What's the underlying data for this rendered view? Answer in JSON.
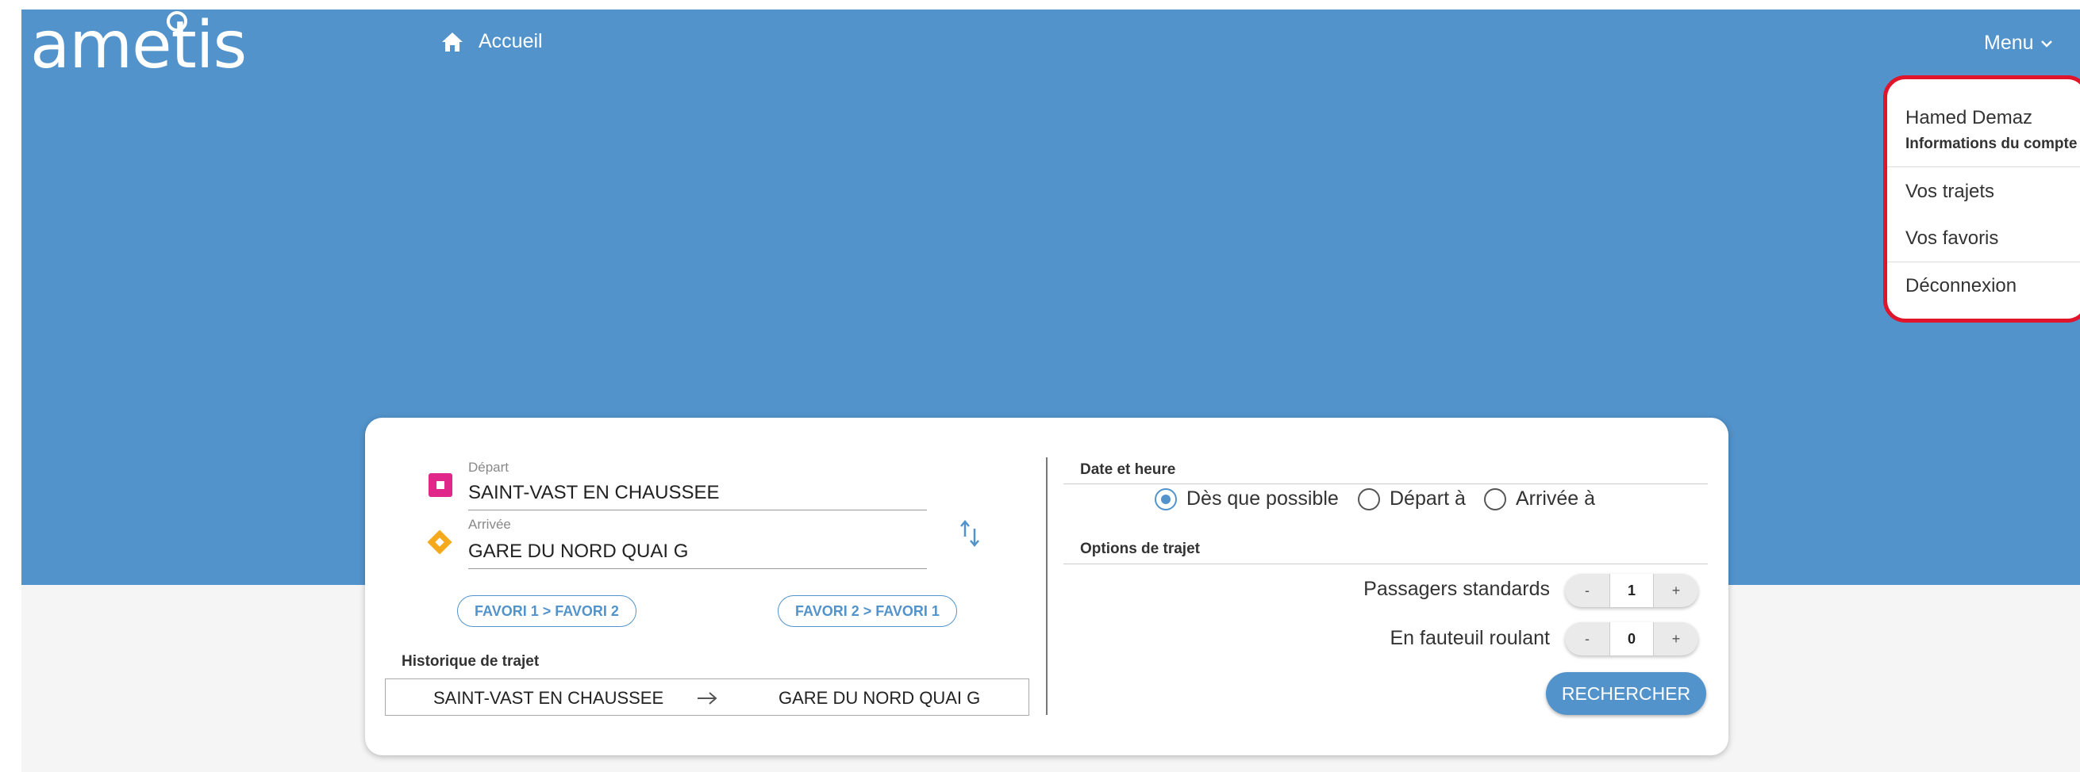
{
  "brand": {
    "logo_text": "ametis"
  },
  "nav": {
    "home_label": "Accueil",
    "menu_label": "Menu"
  },
  "dropdown": {
    "user_name": "Hamed Demaz",
    "account_info": "Informations du compte",
    "trips": "Vos trajets",
    "favorites": "Vos favoris",
    "logout": "Déconnexion"
  },
  "search": {
    "depart": {
      "label": "Départ",
      "value": "SAINT-VAST EN CHAUSSEE"
    },
    "arrivee": {
      "label": "Arrivée",
      "value": "GARE DU NORD QUAI G"
    },
    "favorites": [
      "FAVORI 1 > FAVORI 2",
      "FAVORI 2 > FAVORI 1"
    ],
    "history": {
      "title": "Historique de trajet",
      "from": "SAINT-VAST EN CHAUSSEE",
      "to": "GARE DU NORD QUAI G"
    }
  },
  "datetime": {
    "title": "Date et heure",
    "options": [
      "Dès que possible",
      "Départ à",
      "Arrivée à"
    ],
    "selected": "Dès que possible"
  },
  "trip_options": {
    "title": "Options de trajet",
    "standard_label": "Passagers standards",
    "standard_value": "1",
    "wheelchair_label": "En fauteuil roulant",
    "wheelchair_value": "0",
    "minus": "-",
    "plus": "+"
  },
  "submit_label": "RECHERCHER",
  "colors": {
    "primary": "#5293cb",
    "depart": "#e0278a",
    "arrivee": "#f5a91c",
    "highlight": "#e0142a"
  }
}
